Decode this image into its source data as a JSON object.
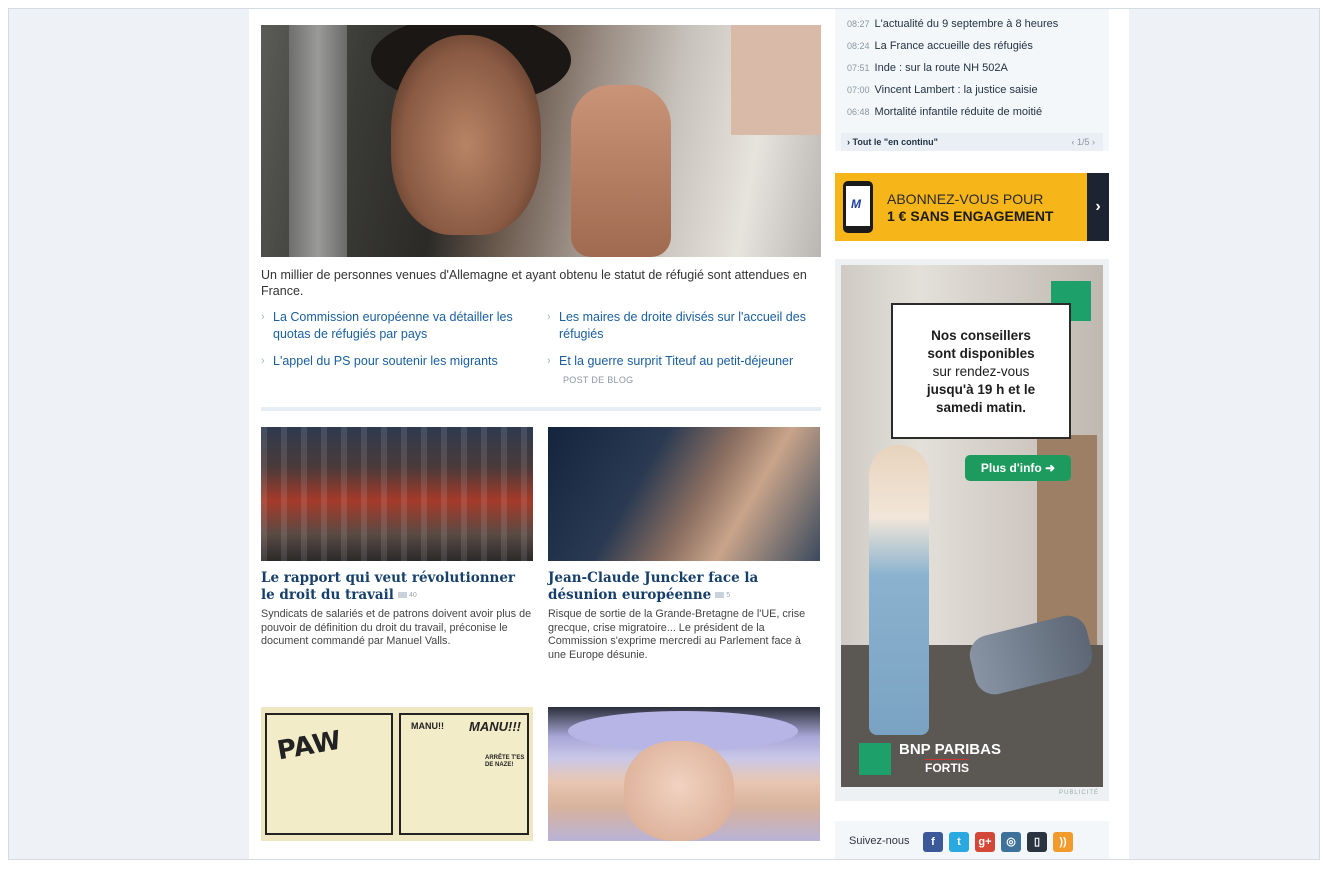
{
  "hero": {
    "caption": "Un millier de personnes venues d'Allemagne et ayant obtenu le statut de réfugié sont attendues en France.",
    "related": [
      {
        "label": "La Commission européenne va détailler les quotas de réfugiés par pays"
      },
      {
        "label": "Les maires de droite divisés sur l'accueil des réfugiés"
      },
      {
        "label": "L'appel du PS pour soutenir les migrants"
      },
      {
        "label": "Et la guerre surprit Titeuf au petit-déjeuner",
        "tag": "POST DE BLOG"
      }
    ]
  },
  "cards": [
    {
      "title": "Le rapport qui veut révolutionner le droit du travail",
      "comments": "40",
      "desc": "Syndicats de salariés et de patrons doivent avoir plus de pouvoir de définition du droit du travail, préconise le document commandé par Manuel Valls."
    },
    {
      "title": "Jean-Claude Juncker face la désunion européenne",
      "comments": "5",
      "desc": "Risque de sortie de la Grande-Bretagne de l'UE, crise grecque, crise migratoire... Le président de la Commission s'exprime mercredi au Parlement face à une Europe désunie."
    }
  ],
  "comic": {
    "bubble1": "MANU!!",
    "bubble2": "MANU!!!",
    "bubble3": "ARRÊTE T'ES DE NAZE!",
    "sfx": "PAW"
  },
  "live": {
    "items": [
      {
        "time": "08:27",
        "title": "L'actualité du 9 septembre à 8 heures"
      },
      {
        "time": "08:24",
        "title": "La France accueille des réfugiés"
      },
      {
        "time": "07:51",
        "title": "Inde : sur la route NH 502A"
      },
      {
        "time": "07:00",
        "title": "Vincent Lambert : la justice saisie"
      },
      {
        "time": "06:48",
        "title": "Mortalité infantile réduite de moitié"
      }
    ],
    "all_label": "› Tout le \"en continu\"",
    "pager": "‹ 1/5 ›"
  },
  "promo": {
    "line1": "ABONNEZ-VOUS POUR",
    "line2": "1 € SANS ENGAGEMENT",
    "arrow": "›",
    "phone_logo": "M"
  },
  "ad": {
    "bubble_line1": "Nos conseillers",
    "bubble_line2": "sont disponibles",
    "bubble_line3": "sur rendez-vous",
    "bubble_line4": "jusqu'à 19 h et le",
    "bubble_line5": "samedi matin.",
    "cta": "Plus d'info ➜",
    "brand1": "BNP PARIBAS",
    "brand2": "FORTIS",
    "label": "PUBLICITÉ"
  },
  "follow": {
    "label": "Suivez-nous",
    "icons": [
      {
        "name": "facebook-icon",
        "glyph": "f",
        "color": "#3b5998"
      },
      {
        "name": "twitter-icon",
        "glyph": "t",
        "color": "#2aa9e0"
      },
      {
        "name": "googleplus-icon",
        "glyph": "g+",
        "color": "#d34836"
      },
      {
        "name": "instagram-icon",
        "glyph": "◎",
        "color": "#3f729b"
      },
      {
        "name": "mobile-icon",
        "glyph": "▯",
        "color": "#2a3440"
      },
      {
        "name": "rss-icon",
        "glyph": "))",
        "color": "#f39a2d"
      }
    ]
  }
}
